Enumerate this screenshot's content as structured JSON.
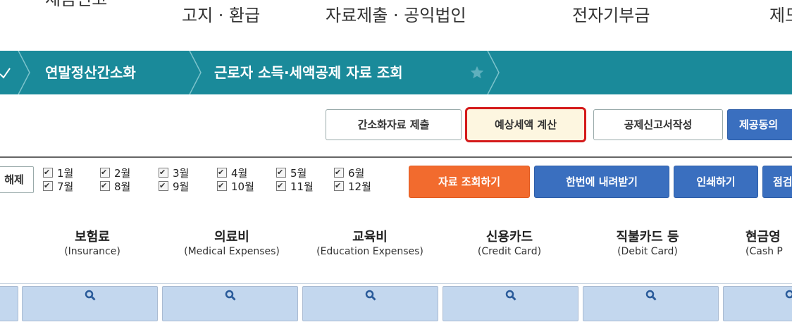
{
  "top_nav": [
    "세금신고",
    "고지 · 환급",
    "자료제출 · 공익법인",
    "전자기부금",
    "제도"
  ],
  "breadcrumb": [
    "연말정산간소화",
    "근로자 소득·세액공제 자료 조회"
  ],
  "action_buttons": [
    "간소화자료 제출",
    "예상세액 계산",
    "공제신고서작성",
    "제공동의"
  ],
  "deselect_button": "해제",
  "months_row1": [
    "1월",
    "2월",
    "3월",
    "4월",
    "5월",
    "6월"
  ],
  "months_row2": [
    "7월",
    "8월",
    "9월",
    "10월",
    "11월",
    "12월"
  ],
  "query_buttons": [
    "자료 조회하기",
    "한번에 내려받기",
    "인쇄하기",
    "점검"
  ],
  "columns": [
    {
      "ko": "보험료",
      "en": "(Insurance)"
    },
    {
      "ko": "의료비",
      "en": "(Medical Expenses)"
    },
    {
      "ko": "교육비",
      "en": "(Education Expenses)"
    },
    {
      "ko": "신용카드",
      "en": "(Credit Card)"
    },
    {
      "ko": "직불카드 등",
      "en": "(Debit Card)"
    },
    {
      "ko": "현금영",
      "en": "(Cash P"
    }
  ],
  "colors": {
    "teal": "#1a8a9a",
    "blue": "#3a6fbf",
    "orange": "#f26b2e",
    "highlight_border": "#d41a1a",
    "search_cell": "#c3d7ee"
  },
  "icons": {
    "breadcrumb_check": "chevron-check-icon",
    "favorite": "star-icon",
    "search": "magnifier-icon"
  }
}
